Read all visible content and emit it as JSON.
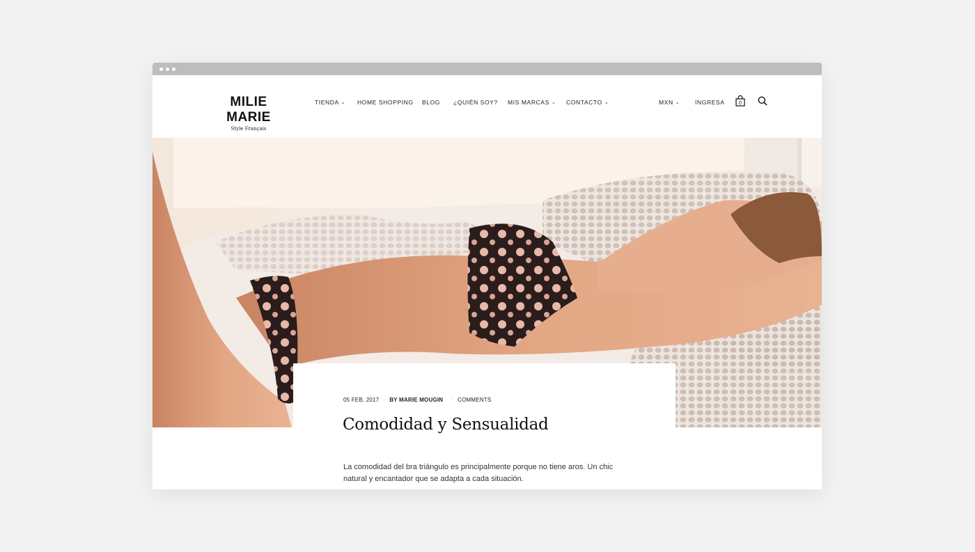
{
  "brand": {
    "name": "MILIE MARIE",
    "tagline": "Style Français"
  },
  "nav": {
    "items": [
      {
        "label": "TIENDA",
        "dropdown": true
      },
      {
        "label": "HOME SHOPPING",
        "dropdown": false
      },
      {
        "label": "BLOG",
        "dropdown": false
      },
      {
        "label": "¿QUIÉN SOY?",
        "dropdown": false
      },
      {
        "label": "MIS MARCAS",
        "dropdown": true
      },
      {
        "label": "CONTACTO",
        "dropdown": true
      }
    ],
    "currency": "MXN",
    "login": "INGRESA",
    "cart_count": "0"
  },
  "post": {
    "date": "05 FEB, 2017",
    "author": "BY MARIE MOUGIN",
    "comments": "COMMENTS",
    "title": "Comodidad y Sensualidad",
    "excerpt": " La comodidad del bra triángulo es principalmente porque no tiene aros. Un chic natural y encantador que se adapta a cada situación."
  },
  "icons": {
    "cart": "shopping-bag-icon",
    "search": "search-icon",
    "chevron": "chevron-down-icon"
  },
  "colors": {
    "background": "#f2f2f2",
    "chrome": "#bdbdbd",
    "text": "#222222"
  }
}
